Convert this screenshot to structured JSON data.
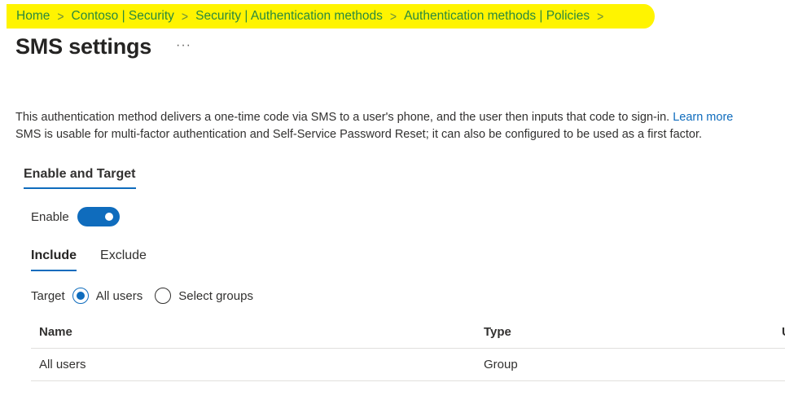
{
  "breadcrumb": {
    "items": [
      "Home",
      "Contoso | Security",
      "Security | Authentication methods",
      "Authentication methods | Policies"
    ],
    "separator": ">"
  },
  "page": {
    "title": "SMS settings",
    "more_label": "···"
  },
  "description": {
    "line1": "This authentication method delivers a one-time code via SMS to a user's phone, and the user then inputs that code to sign-in. ",
    "learn_more": "Learn more",
    "line2": "SMS is usable for multi-factor authentication and Self-Service Password Reset; it can also be configured to be used as a first factor."
  },
  "section": {
    "tab_label": "Enable and Target"
  },
  "enable": {
    "label": "Enable",
    "state": "on"
  },
  "subtabs": {
    "include": "Include",
    "exclude": "Exclude",
    "active": "Include"
  },
  "target": {
    "label": "Target",
    "options": [
      "All users",
      "Select groups"
    ],
    "selected": "All users"
  },
  "table": {
    "columns": [
      "Name",
      "Type",
      "U"
    ],
    "rows": [
      {
        "name": "All users",
        "type": "Group"
      }
    ]
  },
  "colors": {
    "accent": "#0f6cbd",
    "breadcrumb_text": "#2a8a3e",
    "highlight": "#fff400"
  }
}
